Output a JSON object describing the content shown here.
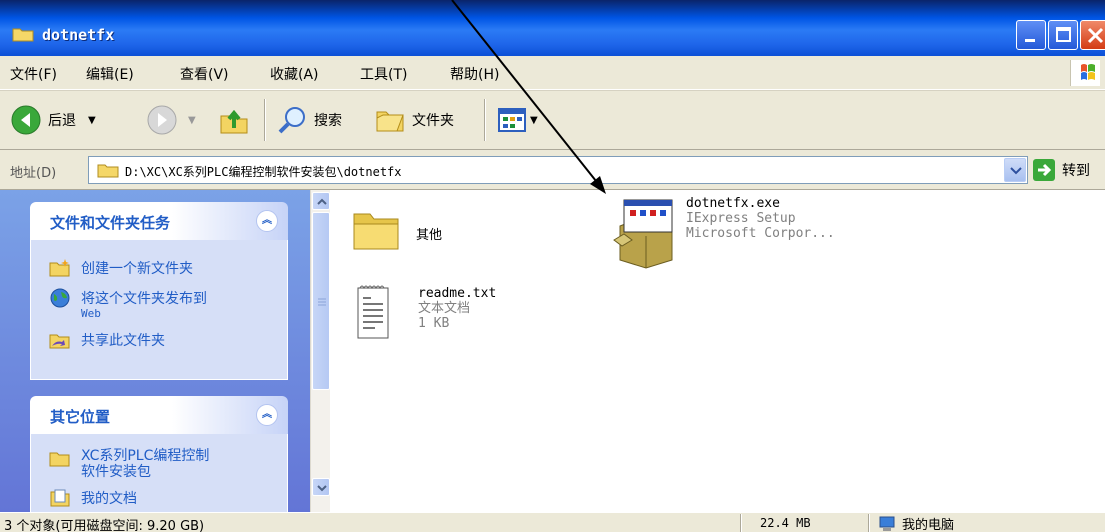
{
  "window": {
    "title": "dotnetfx",
    "buttons": {
      "minimize": "minimize",
      "maximize": "maximize",
      "close": "close"
    }
  },
  "menu": [
    "文件(F)",
    "编辑(E)",
    "查看(V)",
    "收藏(A)",
    "工具(T)",
    "帮助(H)"
  ],
  "toolbar": {
    "back_label": "后退",
    "search_label": "搜索",
    "folders_label": "文件夹"
  },
  "address": {
    "label": "地址(D)",
    "path": "D:\\XC\\XC系列PLC编程控制软件安装包\\dotnetfx",
    "go_label": "转到"
  },
  "tasks_panel": {
    "title": "文件和文件夹任务",
    "items": [
      {
        "label": "创建一个新文件夹"
      },
      {
        "label": "将这个文件夹发布到",
        "sub": "Web"
      },
      {
        "label": "共享此文件夹"
      }
    ]
  },
  "places_panel": {
    "title": "其它位置",
    "items": [
      {
        "label": "XC系列PLC编程控制",
        "line2": "软件安装包"
      },
      {
        "label": "我的文档"
      }
    ]
  },
  "files": [
    {
      "name": "其他",
      "type": "folder"
    },
    {
      "name": "dotnetfx.exe",
      "line2": "IExpress Setup",
      "line3": "Microsoft Corpor...",
      "type": "exe"
    },
    {
      "name": "readme.txt",
      "line2": "文本文档",
      "line3": "1 KB",
      "type": "txt"
    }
  ],
  "status": {
    "objects": "3 个对象(可用磁盘空间: 9.20 GB)",
    "size": "22.4 MB",
    "computer": "我的电脑"
  },
  "colors": {
    "titlebar": "#0055e5",
    "taskpane": "#7ba2e7",
    "link": "#215dc6",
    "chrome": "#ece9d8"
  }
}
